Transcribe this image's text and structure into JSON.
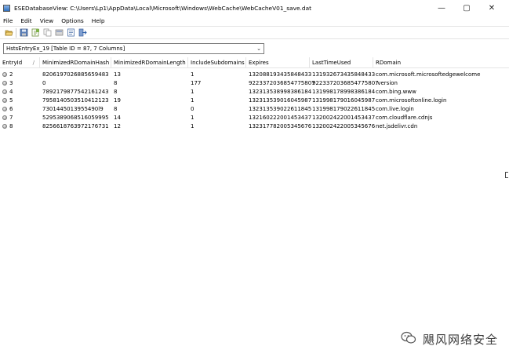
{
  "window": {
    "title": "ESEDatabaseView:  C:\\Users\\Lp1\\AppData\\Local\\Microsoft\\Windows\\WebCache\\WebCacheV01_save.dat",
    "controls": {
      "minimize": "—",
      "maximize": "▢",
      "close": "✕"
    }
  },
  "menu": {
    "items": [
      {
        "label": "File"
      },
      {
        "label": "Edit"
      },
      {
        "label": "View"
      },
      {
        "label": "Options"
      },
      {
        "label": "Help"
      }
    ]
  },
  "toolbar": {
    "buttons": [
      {
        "name": "open-icon"
      },
      {
        "name": "save-icon"
      },
      {
        "name": "export-icon"
      },
      {
        "name": "copy-icon"
      },
      {
        "name": "properties-icon"
      },
      {
        "name": "report-icon"
      },
      {
        "name": "exit-icon"
      }
    ]
  },
  "table_select": {
    "value": "HstsEntryEx_19   [Table ID = 87, 7 Columns]"
  },
  "grid": {
    "columns": [
      "EntryId",
      "MinimizedRDomainHash",
      "MinimizedRDomainLength",
      "IncludeSubdomains",
      "Expires",
      "LastTimeUsed",
      "RDomain"
    ],
    "sort_indicator": "/",
    "rows": [
      [
        "2",
        "8206197026885659483",
        "13",
        "1",
        "132088193435848433",
        "131932673435848433",
        "com.microsoft.microsoftedgewelcome"
      ],
      [
        "3",
        "0",
        "8",
        "177",
        "9223372036854775807",
        "9223372036854775807",
        ":version"
      ],
      [
        "4",
        "7892179877542161243",
        "8",
        "1",
        "132313538998386184",
        "131998178998386184",
        "com.bing.www"
      ],
      [
        "5",
        "7958140503510412123",
        "19",
        "1",
        "132313539016045987",
        "131998179016045987",
        "com.microsoftonline.login"
      ],
      [
        "6",
        "7301445013955490l9",
        "8",
        "0",
        "132313539022611845",
        "131998179022611845",
        "com.live.login"
      ],
      [
        "7",
        "5295389068516059995",
        "14",
        "1",
        "132160222001453437",
        "132002422001453437",
        "com.cloudflare.cdnjs"
      ],
      [
        "8",
        "8256618763972176731",
        "12",
        "1",
        "132317782005345676",
        "132002422005345676",
        "net.jsdelivr.cdn"
      ]
    ]
  },
  "watermark": {
    "text": "飓风网络安全"
  }
}
